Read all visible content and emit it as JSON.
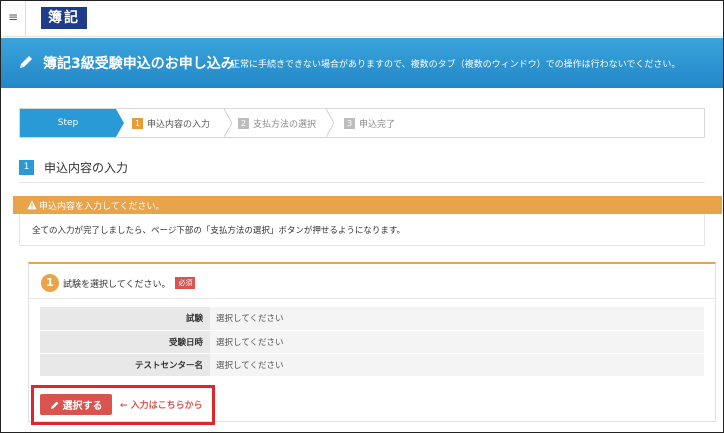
{
  "header": {
    "menu_icon": "hamburger-icon",
    "menu_glyph": "≡",
    "logo_text": "簿記"
  },
  "banner": {
    "title": "簿記3級受験申込のお申し込み",
    "note": "正常に手続きできない場合がありますので、複数のタブ（複数のウィンドウ）での操作は行わないでください。",
    "icon": "pencil-icon"
  },
  "steps": {
    "active_label": "Step",
    "items": [
      {
        "num": "1",
        "label": "申込内容の入力",
        "state": "current"
      },
      {
        "num": "2",
        "label": "支払方法の選択",
        "state": "pending"
      },
      {
        "num": "3",
        "label": "申込完了",
        "state": "pending"
      }
    ]
  },
  "section": {
    "num": "1",
    "title": "申込内容の入力"
  },
  "warning": {
    "icon": "warning-icon",
    "text": "申込内容を入力してください。"
  },
  "info": {
    "text": "全ての入力が完了しましたら、ページ下部の「支払方法の選択」ボタンが押せるようになります。"
  },
  "exam_card": {
    "num": "1",
    "title": "試験を選択してください。",
    "required_badge": "必須",
    "rows": [
      {
        "label": "試験",
        "value": "選択してください"
      },
      {
        "label": "受験日時",
        "value": "選択してください"
      },
      {
        "label": "テストセンター名",
        "value": "選択してください"
      }
    ],
    "select_button": "選択する",
    "hint_link": "← 入力はこちらから"
  },
  "colors": {
    "brand_blue": "#2a9ad6",
    "logo_navy": "#1f3c88",
    "warning_orange": "#e9a34a",
    "button_red": "#d9534f",
    "highlight_red": "#e0262a"
  }
}
